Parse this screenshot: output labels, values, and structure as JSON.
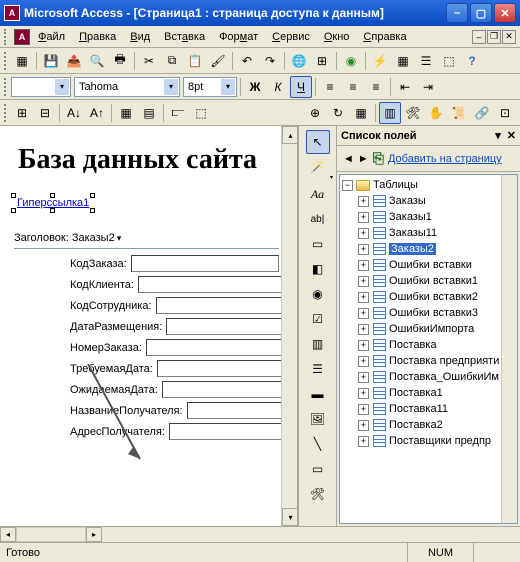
{
  "titlebar": {
    "app": "Microsoft Access",
    "doc": "[Страница1 : страница доступа к данным]"
  },
  "menu": {
    "file": "Файл",
    "edit": "Правка",
    "view": "Вид",
    "insert": "Вставка",
    "format": "Формат",
    "tools": "Сервис",
    "window": "Окно",
    "help": "Справка"
  },
  "format_toolbar": {
    "font": "Tahoma",
    "size": "8pt",
    "bold": "Ж",
    "italic": "К",
    "underline": "Ч"
  },
  "canvas": {
    "heading": "База данных сайта",
    "hyperlink": "Гиперссылка1",
    "section_label": "Заголовок: Заказы2",
    "fields": [
      "КодЗаказа:",
      "КодКлиента:",
      "КодСотрудника:",
      "ДатаРазмещения:",
      "НомерЗаказа:",
      "ТребуемаяДата:",
      "ОжидаемаяДата:",
      "НазваниеПолучателя:",
      "АдресПолучателя:"
    ]
  },
  "toolbox": {
    "cursor": "↖",
    "label": "Aa",
    "textbox": "ab|"
  },
  "fieldlist": {
    "title": "Список полей",
    "add_link": "Добавить на страницу",
    "root": "Таблицы",
    "tables": [
      "Заказы",
      "Заказы1",
      "Заказы11",
      "Заказы2",
      "Ошибки вставки",
      "Ошибки вставки1",
      "Ошибки вставки2",
      "Ошибки вставки3",
      "ОшибкиИмпорта",
      "Поставка",
      "Поставка предприяти",
      "Поставка_ОшибкиИм",
      "Поставка1",
      "Поставка11",
      "Поставка2",
      "Поставщики предпр"
    ],
    "selected_index": 3
  },
  "status": {
    "ready": "Готово",
    "num": "NUM"
  }
}
